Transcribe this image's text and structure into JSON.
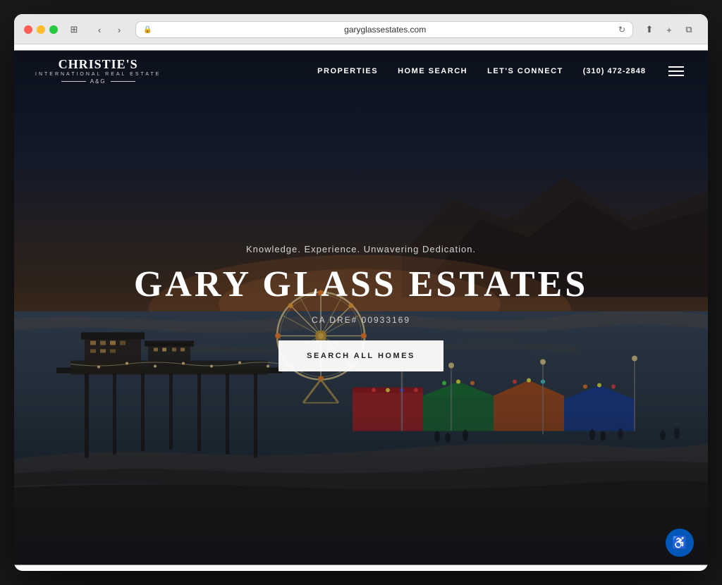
{
  "browser": {
    "url": "garyglassestates.com",
    "back_label": "‹",
    "forward_label": "›",
    "reload_label": "↻"
  },
  "nav": {
    "logo_main": "CHRISTIE'S",
    "logo_sub": "INTERNATIONAL REAL ESTATE",
    "logo_akg": "A&G",
    "links": [
      {
        "label": "PROPERTIES",
        "id": "properties"
      },
      {
        "label": "HOME SEARCH",
        "id": "home-search"
      },
      {
        "label": "LET'S CONNECT",
        "id": "lets-connect"
      }
    ],
    "phone": "(310) 472-2848",
    "menu_label": "☰"
  },
  "hero": {
    "tagline": "Knowledge. Experience. Unwavering Dedication.",
    "title": "GARY GLASS ESTATES",
    "license": "CA DRE# 00933169",
    "cta_label": "SEARCH ALL HOMES"
  },
  "accessibility": {
    "btn_label": "♿"
  }
}
